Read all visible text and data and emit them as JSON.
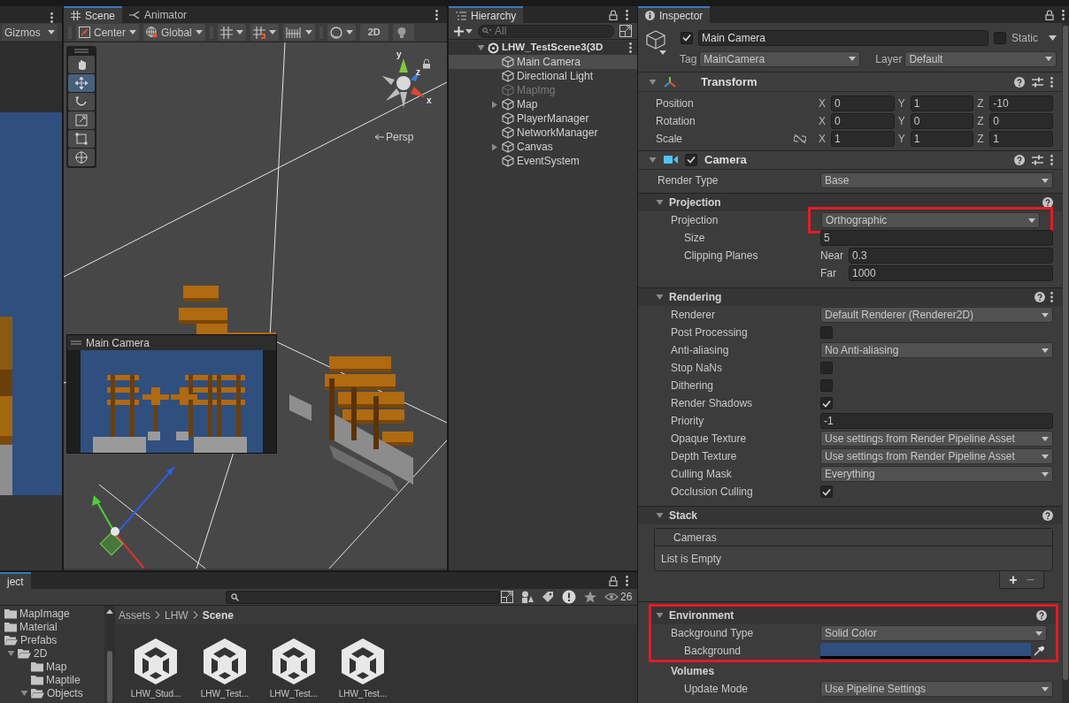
{
  "game_view": {
    "gizmos": "Gizmos"
  },
  "scene": {
    "tabs": [
      {
        "label": "Scene",
        "kind": "scene",
        "selected": true
      },
      {
        "label": "Animator",
        "kind": "animator",
        "selected": false
      }
    ],
    "pivot": "Center",
    "space": "Global",
    "mode_2d": {
      "label": "2D",
      "on": false
    },
    "tools": [
      {
        "kind": "hand",
        "selected": false
      },
      {
        "kind": "move",
        "selected": true
      },
      {
        "kind": "rotate",
        "selected": false
      },
      {
        "kind": "scale",
        "selected": false
      },
      {
        "kind": "rect",
        "selected": false
      },
      {
        "kind": "transform",
        "selected": false
      }
    ],
    "axes": [
      "y",
      "z",
      "x"
    ],
    "projection_label": "Persp",
    "camera_preview": {
      "title": "Main Camera"
    }
  },
  "hierarchy": {
    "title": "Hierarchy",
    "search_placeholder": "All",
    "scene": {
      "label": "LHW_TestScene3(3D",
      "expanded": true
    },
    "items": [
      {
        "label": "Main Camera",
        "selected": true,
        "active": true,
        "expandable": false
      },
      {
        "label": "Directional Light",
        "selected": false,
        "active": true,
        "expandable": false
      },
      {
        "label": "MapImg",
        "selected": false,
        "active": false,
        "expandable": false
      },
      {
        "label": "Map",
        "selected": false,
        "active": true,
        "expandable": true
      },
      {
        "label": "PlayerManager",
        "selected": false,
        "active": true,
        "expandable": false
      },
      {
        "label": "NetworkManager",
        "selected": false,
        "active": true,
        "expandable": false
      },
      {
        "label": "Canvas",
        "selected": false,
        "active": true,
        "expandable": true
      },
      {
        "label": "EventSystem",
        "selected": false,
        "active": true,
        "expandable": false
      }
    ]
  },
  "project": {
    "title": "ject",
    "hidden_count": "26",
    "folders": [
      {
        "label": "MapImage",
        "expanded": false
      },
      {
        "label": "Material",
        "expanded": false
      },
      {
        "label": "Prefabs",
        "expanded": true,
        "children": [
          {
            "label": "2D",
            "expanded": true,
            "children": [
              {
                "label": "Map",
                "expanded": false
              },
              {
                "label": "Maptile",
                "expanded": false
              },
              {
                "label": "Objects",
                "expanded": true
              }
            ]
          }
        ]
      }
    ],
    "breadcrumb": [
      {
        "label": "Assets",
        "current": false
      },
      {
        "label": "LHW",
        "current": false
      },
      {
        "label": "Scene",
        "current": true
      }
    ],
    "assets": [
      {
        "label": "LHW_Stud..."
      },
      {
        "label": "LHW_Test..."
      },
      {
        "label": "LHW_Test..."
      },
      {
        "label": "LHW_Test..."
      }
    ]
  },
  "inspector": {
    "title": "Inspector",
    "object": {
      "active": true,
      "name": "Main Camera",
      "static": false,
      "static_label": "Static",
      "tag_label": "Tag",
      "tag": "MainCamera",
      "layer_label": "Layer",
      "layer": "Default"
    },
    "transform": {
      "title": "Transform",
      "rows": [
        {
          "label": "Position",
          "values": [
            {
              "axis": "X",
              "value": "0"
            },
            {
              "axis": "Y",
              "value": "1"
            },
            {
              "axis": "Z",
              "value": "-10"
            }
          ]
        },
        {
          "label": "Rotation",
          "values": [
            {
              "axis": "X",
              "value": "0"
            },
            {
              "axis": "Y",
              "value": "0"
            },
            {
              "axis": "Z",
              "value": "0"
            }
          ]
        },
        {
          "label": "Scale",
          "linked": false,
          "values": [
            {
              "axis": "X",
              "value": "1"
            },
            {
              "axis": "Y",
              "value": "1"
            },
            {
              "axis": "Z",
              "value": "1"
            }
          ]
        }
      ]
    },
    "camera": {
      "title": "Camera",
      "enabled": true,
      "rows": [
        {
          "kind": "dropdown",
          "label": "Render Type",
          "value": "Base"
        }
      ],
      "sections": [
        {
          "title": "Projection",
          "expanded": true,
          "highlighted": false,
          "menu": false,
          "rows": [
            {
              "kind": "dropdown",
              "label": "Projection",
              "value": "Orthographic",
              "highlighted": true,
              "children": [
                {
                  "kind": "number",
                  "label": "Size",
                  "value": "5"
                },
                {
                  "kind": "range",
                  "label": "Clipping Planes",
                  "fields": [
                    {
                      "label": "Near",
                      "value": "0.3"
                    },
                    {
                      "label": "Far",
                      "value": "1000"
                    }
                  ]
                }
              ]
            }
          ]
        },
        {
          "title": "Rendering",
          "expanded": true,
          "highlighted": false,
          "menu": true,
          "rows": [
            {
              "kind": "dropdown",
              "label": "Renderer",
              "value": "Default Renderer (Renderer2D)"
            },
            {
              "kind": "checkbox",
              "label": "Post Processing",
              "checked": false
            },
            {
              "kind": "dropdown",
              "label": "Anti-aliasing",
              "value": "No Anti-aliasing"
            },
            {
              "kind": "checkbox",
              "label": "Stop NaNs",
              "checked": false
            },
            {
              "kind": "checkbox",
              "label": "Dithering",
              "checked": false
            },
            {
              "kind": "checkbox",
              "label": "Render Shadows",
              "checked": true
            },
            {
              "kind": "number",
              "label": "Priority",
              "value": "-1"
            },
            {
              "kind": "dropdown",
              "label": "Opaque Texture",
              "value": "Use settings from Render Pipeline Asset"
            },
            {
              "kind": "dropdown",
              "label": "Depth Texture",
              "value": "Use settings from Render Pipeline Asset"
            },
            {
              "kind": "dropdown",
              "label": "Culling Mask",
              "value": "Everything"
            },
            {
              "kind": "checkbox",
              "label": "Occlusion Culling",
              "checked": true
            }
          ]
        },
        {
          "title": "Stack",
          "expanded": true,
          "highlighted": false,
          "menu": false,
          "rows": [
            {
              "kind": "list",
              "header": "Cameras",
              "empty": "List is Empty",
              "add": "+",
              "remove": "−"
            }
          ]
        },
        {
          "title": "Environment",
          "expanded": true,
          "highlighted": true,
          "menu": false,
          "rows": [
            {
              "kind": "dropdown",
              "label": "Background Type",
              "value": "Solid Color",
              "highlighted": true,
              "children": [
                {
                  "kind": "color",
                  "label": "Background",
                  "color": "#2f4f7f"
                }
              ]
            },
            {
              "kind": "group",
              "label": "Volumes",
              "children": [
                {
                  "kind": "dropdown",
                  "label": "Update Mode",
                  "value": "Use Pipeline Settings"
                }
              ]
            }
          ]
        }
      ]
    }
  }
}
